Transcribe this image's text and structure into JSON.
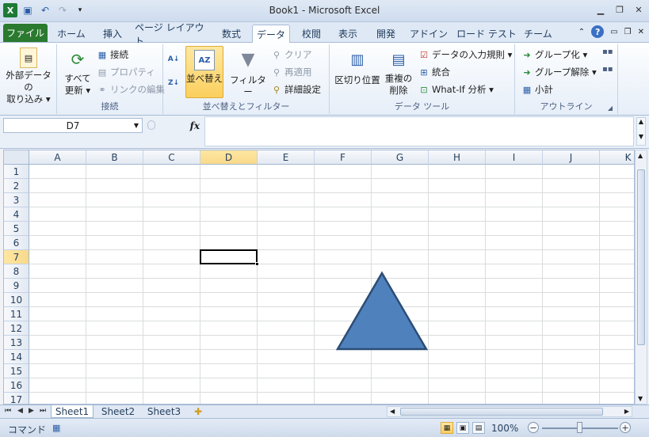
{
  "window": {
    "title": "Book1 - Microsoft Excel",
    "qat": [
      "excel-app-icon",
      "save-icon",
      "undo-icon",
      "redo-icon",
      "customize-qat-icon"
    ]
  },
  "tabs": {
    "file": "ファイル",
    "items": [
      "ホーム",
      "挿入",
      "ページ レイアウト",
      "数式",
      "データ",
      "校閲",
      "表示",
      "開発",
      "アドイン",
      "ロード テスト",
      "チーム"
    ],
    "active": "データ"
  },
  "ribbon": {
    "groups": {
      "external": {
        "button": "外部データの取り込み",
        "line1": "外部データの",
        "line2": "取り込み ▾"
      },
      "connections": {
        "label": "接続",
        "refresh_line1": "すべて",
        "refresh_line2": "更新 ▾",
        "items": [
          "接続",
          "プロパティ",
          "リンクの編集"
        ]
      },
      "sort_filter": {
        "label": "並べ替えとフィルター",
        "sort": "並べ替え",
        "filter": "フィルター",
        "small": [
          "クリア",
          "再適用",
          "詳細設定"
        ]
      },
      "data_tools": {
        "label": "データ ツール",
        "text_to_columns": "区切り位置",
        "remove_dup_line1": "重複の",
        "remove_dup_line2": "削除",
        "small": [
          "データの入力規則 ▾",
          "統合",
          "What-If 分析 ▾"
        ]
      },
      "outline": {
        "label": "アウトライン",
        "items": [
          "グループ化 ▾",
          "グループ解除 ▾",
          "小計"
        ]
      }
    }
  },
  "formula_bar": {
    "name_box": "D7",
    "fx": "fx",
    "value": ""
  },
  "grid": {
    "columns": [
      "A",
      "B",
      "C",
      "D",
      "E",
      "F",
      "G",
      "H",
      "I",
      "J",
      "K"
    ],
    "rows": [
      "1",
      "2",
      "3",
      "4",
      "5",
      "6",
      "7",
      "8",
      "9",
      "10",
      "11",
      "12",
      "13",
      "14",
      "15",
      "16",
      "17"
    ],
    "selected_column": "D",
    "selected_row": "7",
    "shape": {
      "type": "triangle",
      "fill": "#4f81bd",
      "stroke": "#2c4d75"
    }
  },
  "sheets": {
    "tabs": [
      "Sheet1",
      "Sheet2",
      "Sheet3"
    ],
    "active": "Sheet1"
  },
  "status": {
    "mode": "コマンド",
    "zoom": "100%"
  }
}
